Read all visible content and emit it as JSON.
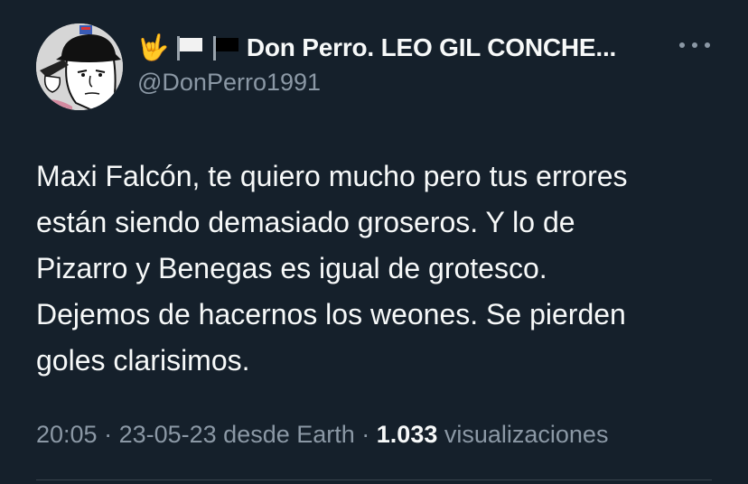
{
  "tweet": {
    "author": {
      "display_name": "Don Perro. LEO GIL CONCHE...",
      "handle": "@DonPerro1991",
      "name_emojis": [
        "🤟",
        "white-flag-icon",
        "black-flag-icon"
      ]
    },
    "text_lines": [
      "Maxi Falcón, te quiero mucho pero tus errores",
      "están siendo demasiado groseros. Y lo de",
      "Pizarro y Benegas es igual de grotesco.",
      "Dejemos de hacernos los weones. Se pierden",
      "goles clarisimos."
    ],
    "meta": {
      "time": "20:05",
      "sep1": " · ",
      "date": "23-05-23",
      "source": " desde Earth",
      "sep2": " · ",
      "views_count": "1.033",
      "views_label": " visualizaciones"
    }
  },
  "colors": {
    "background": "#15202b",
    "text_primary": "#f7f9f9",
    "text_secondary": "#8b98a5",
    "divider": "#38444d"
  }
}
